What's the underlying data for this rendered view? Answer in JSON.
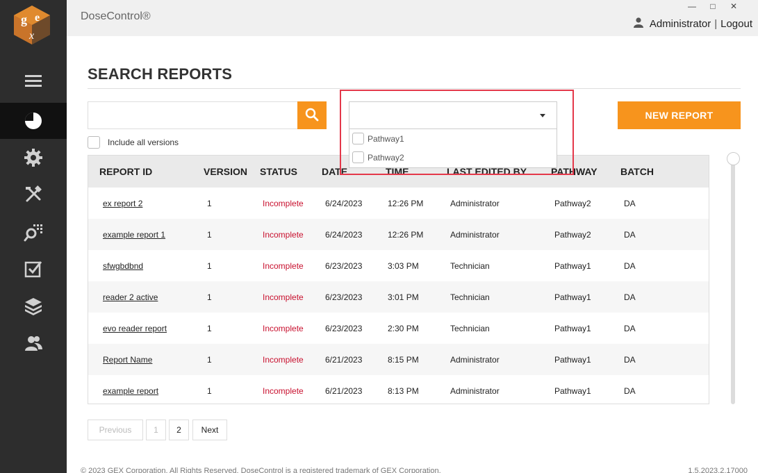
{
  "app": {
    "title": "DoseControl®"
  },
  "window_controls": {
    "minimize": "—",
    "maximize": "□",
    "close": "✕"
  },
  "user": {
    "name": "Administrator",
    "separator": "|",
    "logout": "Logout"
  },
  "sidebar": {
    "items": [
      {
        "name": "menu-icon",
        "active": false
      },
      {
        "name": "dashboard-icon",
        "active": true
      },
      {
        "name": "settings-icon",
        "active": false
      },
      {
        "name": "tools-icon",
        "active": false
      },
      {
        "name": "search-reports-icon",
        "active": false
      },
      {
        "name": "checklist-icon",
        "active": false
      },
      {
        "name": "layers-icon",
        "active": false
      },
      {
        "name": "users-icon",
        "active": false
      }
    ]
  },
  "page": {
    "title": "SEARCH REPORTS"
  },
  "search": {
    "value": "",
    "placeholder": ""
  },
  "include_all_versions": {
    "label": "Include all versions",
    "checked": false
  },
  "pathway_filter": {
    "value": "",
    "options": [
      {
        "label": "Pathway1",
        "checked": false
      },
      {
        "label": "Pathway2",
        "checked": false
      }
    ]
  },
  "new_report": {
    "label": "NEW REPORT"
  },
  "table": {
    "headers": [
      "REPORT ID",
      "VERSION",
      "STATUS",
      "DATE",
      "TIME",
      "LAST EDITED BY",
      "PATHWAY",
      "BATCH"
    ],
    "rows": [
      {
        "report_id": "ex report 2",
        "version": "1",
        "status": "Incomplete",
        "date": "6/24/2023",
        "time": "12:26 PM",
        "edited_by": "Administrator",
        "pathway": "Pathway2",
        "batch": "DA"
      },
      {
        "report_id": "example report 1",
        "version": "1",
        "status": "Incomplete",
        "date": "6/24/2023",
        "time": "12:26 PM",
        "edited_by": "Administrator",
        "pathway": "Pathway2",
        "batch": "DA"
      },
      {
        "report_id": "sfwgbdbnd",
        "version": "1",
        "status": "Incomplete",
        "date": "6/23/2023",
        "time": "3:03 PM",
        "edited_by": "Technician",
        "pathway": "Pathway1",
        "batch": "DA"
      },
      {
        "report_id": "reader 2 active",
        "version": "1",
        "status": "Incomplete",
        "date": "6/23/2023",
        "time": "3:01 PM",
        "edited_by": "Technician",
        "pathway": "Pathway1",
        "batch": "DA"
      },
      {
        "report_id": "evo reader report",
        "version": "1",
        "status": "Incomplete",
        "date": "6/23/2023",
        "time": "2:30 PM",
        "edited_by": "Technician",
        "pathway": "Pathway1",
        "batch": "DA"
      },
      {
        "report_id": "Report Name",
        "version": "1",
        "status": "Incomplete",
        "date": "6/21/2023",
        "time": "8:15 PM",
        "edited_by": "Administrator",
        "pathway": "Pathway1",
        "batch": "DA"
      },
      {
        "report_id": "example report",
        "version": "1",
        "status": "Incomplete",
        "date": "6/21/2023",
        "time": "8:13 PM",
        "edited_by": "Administrator",
        "pathway": "Pathway1",
        "batch": "DA"
      }
    ]
  },
  "pagination": {
    "previous": "Previous",
    "pages": [
      "1",
      "2"
    ],
    "current": "2",
    "next": "Next"
  },
  "footer": {
    "copyright": "© 2023 GEX Corporation. All Rights Reserved. DoseControl is a registered trademark of GEX Corporation.",
    "version": "1.5.2023.2.17000"
  },
  "colors": {
    "accent": "#f7941d",
    "sidebar": "#2d2d2d",
    "status_incomplete": "#c8102e",
    "highlight": "#e4384a"
  }
}
